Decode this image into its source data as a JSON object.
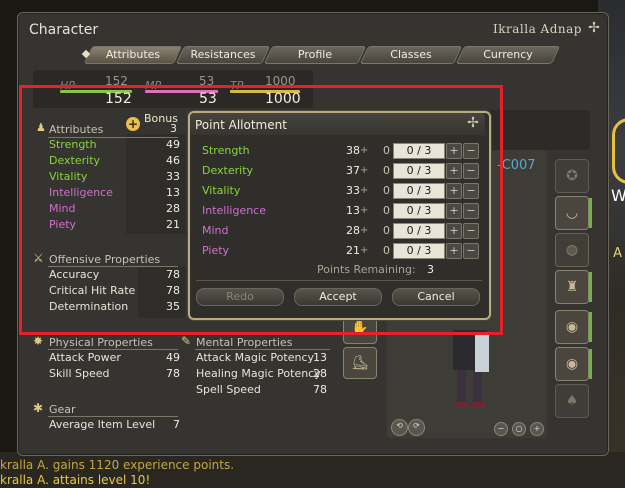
{
  "window": {
    "title": "Character",
    "character_name": "Ikralla Adnap"
  },
  "tabs": [
    "Attributes",
    "Resistances",
    "Profile",
    "Classes",
    "Currency"
  ],
  "stats": {
    "hp": {
      "label": "HP",
      "small": "152",
      "value": "152",
      "color": "#8bc34a"
    },
    "mp": {
      "label": "MP",
      "small": "53",
      "value": "53",
      "color": "#e070b8"
    },
    "tp": {
      "label": "TP",
      "small": "1000",
      "value": "1000",
      "color": "#d8b84a"
    }
  },
  "attributes": {
    "heading": "Attributes",
    "bonus_label": "Bonus",
    "bonus_value": "3",
    "rows": [
      {
        "label": "Strength",
        "value": "49",
        "color": "#8bd43a"
      },
      {
        "label": "Dexterity",
        "value": "46",
        "color": "#8bd43a"
      },
      {
        "label": "Vitality",
        "value": "33",
        "color": "#8bd43a"
      },
      {
        "label": "Intelligence",
        "value": "13",
        "color": "#d070d0"
      },
      {
        "label": "Mind",
        "value": "28",
        "color": "#d070d0"
      },
      {
        "label": "Piety",
        "value": "21",
        "color": "#d070d0"
      }
    ]
  },
  "offensive": {
    "heading": "Offensive Properties",
    "rows": [
      {
        "label": "Accuracy",
        "value": "78"
      },
      {
        "label": "Critical Hit Rate",
        "value": "78"
      },
      {
        "label": "Determination",
        "value": "35"
      }
    ]
  },
  "physical": {
    "heading": "Physical Properties",
    "rows": [
      {
        "label": "Attack Power",
        "value": "49"
      },
      {
        "label": "Skill Speed",
        "value": "78"
      }
    ]
  },
  "mental": {
    "heading": "Mental Properties",
    "rows": [
      {
        "label": "Attack Magic Potency",
        "value": "13"
      },
      {
        "label": "Healing Magic Potency",
        "value": "28"
      },
      {
        "label": "Spell Speed",
        "value": "78"
      }
    ]
  },
  "gear": {
    "heading": "Gear",
    "rows": [
      {
        "label": "Average Item Level",
        "value": "7"
      }
    ]
  },
  "dialog": {
    "title": "Point Allotment",
    "rows": [
      {
        "label": "Strength",
        "value": "38",
        "plus": "+",
        "zero": "0",
        "alloc": "0 / 3",
        "color": "#8bd43a"
      },
      {
        "label": "Dexterity",
        "value": "37",
        "plus": "+",
        "zero": "0",
        "alloc": "0 / 3",
        "color": "#8bd43a"
      },
      {
        "label": "Vitality",
        "value": "33",
        "plus": "+",
        "zero": "0",
        "alloc": "0 / 3",
        "color": "#8bd43a"
      },
      {
        "label": "Intelligence",
        "value": "13",
        "plus": "+",
        "zero": "0",
        "alloc": "0 / 3",
        "color": "#d070d0"
      },
      {
        "label": "Mind",
        "value": "28",
        "plus": "+",
        "zero": "0",
        "alloc": "0 / 3",
        "color": "#d070d0"
      },
      {
        "label": "Piety",
        "value": "21",
        "plus": "+",
        "zero": "0",
        "alloc": "0 / 3",
        "color": "#d070d0"
      }
    ],
    "points_remaining_label": "Points Remaining:",
    "points_remaining_value": "3",
    "redo_label": "Redo",
    "accept_label": "Accept",
    "cancel_label": "Cancel",
    "plus_glyph": "+",
    "minus_glyph": "−"
  },
  "partial_text": {
    "id_fragment": "-C007",
    "w": "W",
    "a": "a A"
  },
  "chat": [
    "kralla A. gains 1120 experience points.",
    "kralla A. attains level 10!"
  ]
}
